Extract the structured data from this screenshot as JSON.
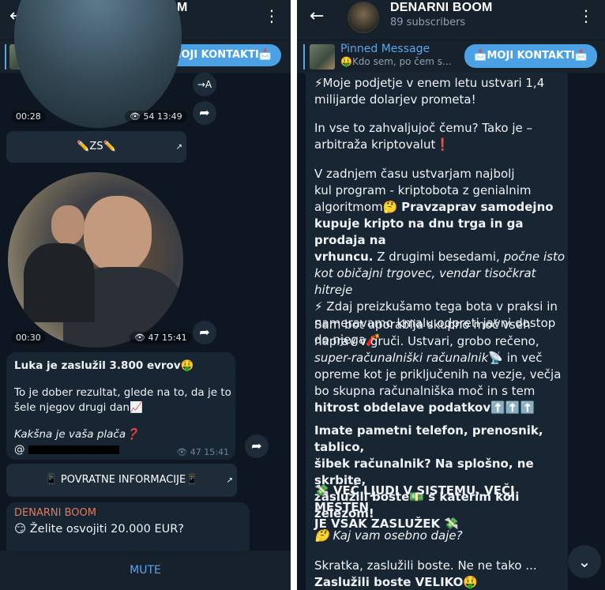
{
  "channel": {
    "name": "DENARNI BOOM",
    "subscribers": "89 subscribers",
    "back_icon": "←",
    "menu_icon": "⋮"
  },
  "pinned": {
    "label": "Pinned Message",
    "preview": "🤑Kdo sem, po čem s...",
    "button": "📩MOJI KONTAKTI📩"
  },
  "left": {
    "video1": {
      "duration": "00:28",
      "views": "54",
      "time": "13:49"
    },
    "translate_icon_label": "→A",
    "button_zs": "✏️ZS✏️",
    "video2": {
      "duration": "00:30",
      "views": "47",
      "time": "15:41"
    },
    "message": {
      "line1": "Luka je zaslužil 3.800 evrov🤑",
      "line2": "To je dober rezultat, glede na to, da je to",
      "line3": "šele njegov drugi dan📈",
      "line4": "Kakšna je vaša plača❓",
      "mention": "@",
      "views": "47",
      "time": "15:41"
    },
    "button_feedback": "📱 POVRATNE INFORMACIJE📱",
    "preview": {
      "author": "DENARNI BOOM",
      "text": "😏 Želite osvojiti 20.000 EUR?"
    },
    "mute_label": "MUTE"
  },
  "right": {
    "p1a": "⚡Moje podjetje v enem letu ustvari 1,4",
    "p1b": "milijarde dolarjev prometa!",
    "p2a": "In vse to zahvaljujoč čemu? Tako je –",
    "p2b": "arbitraža kriptovalut❗",
    "p3a": "V zadnjem času ustvarjam najbolj",
    "p3b": "kul program - kriptobota z genialnim",
    "p3c_plain": "algoritmom🤔 ",
    "p3c_bold": "Pravzaprav samodejno",
    "p3d_bold": "kupuje kripto na dnu trga in ga prodaja na",
    "p3e_bold": "vrhuncu.",
    "p3e_plain": " Z drugimi besedami, ",
    "p3e_ital": "počne isto",
    "p3f_ital": "kot običajni trgovec, vendar tisočkrat hitreje",
    "p3g": "⚡ Zdaj preizkušamo tega bota v praksi in",
    "p3h": "nameravamo kmalu odpreti javni dostop",
    "p3i": "do njega🧨",
    "p4a": "Sam bot uporablja skupno moč vseh",
    "p4b": "naprav v gruči. Ustvari, grobo rečeno,",
    "p4c_ital": "super-računalniški računalnik",
    "p4c_plain": "📡 in več",
    "p4d": "opreme kot je priključenih na vezje, večja",
    "p4e": "bo skupna računalniška moč in s tem",
    "p4f_bold": "hitrost obdelave podatkov",
    "p4f_emoji": "⬆️⬆️⬆️",
    "p5a": "Imate pametni telefon, prenosnik, tablico,",
    "p5b": "šibek računalnik? Na splošno, ne skrbite,",
    "p5c": "zaslužili boste💵 s katerim koli železom!",
    "p6a": "💸 VEČ LJUDI V SISTEMU, VEČJ MESTEN",
    "p6b": "JE VSAK ZASLUŽEK 💸",
    "p7": "🤔 Kaj vam osebno daje?",
    "p8a": "Skratka, zaslužili boste. Ne ne tako ...",
    "p8b": "Zaslužili boste VELIKO🤑"
  },
  "colors": {
    "header_bg": "#17212b",
    "chat_bg": "#0e1621",
    "bubble_bg": "#182533",
    "accent": "#5ea5e6",
    "button_blue": "#4ca0e4"
  }
}
